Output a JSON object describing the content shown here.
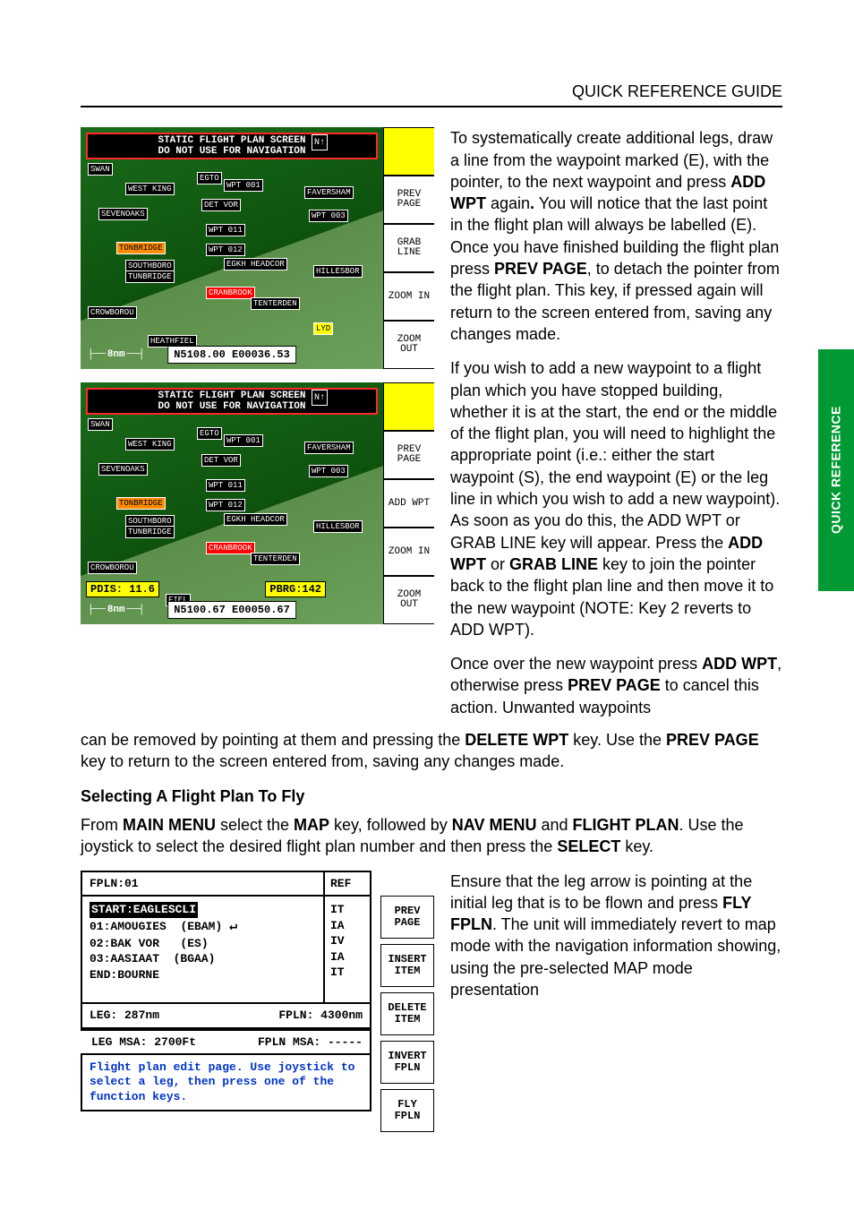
{
  "header": {
    "title": "QUICK REFERENCE GUIDE"
  },
  "side_tab": "QUICK REFERENCE",
  "screens": {
    "banner_line1": "STATIC FLIGHT PLAN SCREEN",
    "banner_line2": "DO NOT USE FOR NAVIGATION",
    "north": "N↑",
    "scale": "8nm",
    "screen1": {
      "coord": "N5108.00 E00036.53",
      "softkeys": [
        "",
        "PREV PAGE",
        "GRAB LINE",
        "ZOOM IN",
        "ZOOM OUT"
      ],
      "labels": {
        "swan": "SWAN",
        "west_king": "WEST KING",
        "det_vor": "DET VOR",
        "sevenoaks": "SEVENOAKS",
        "tonbridge": "TONBRIDGE",
        "southboro": "SOUTHBORO",
        "tunbridge": "TUNBRIDGE",
        "cranbrook": "CRANBROOK",
        "tenterden": "TENTERDEN",
        "crowborou": "CROWBOROU",
        "heathfiel": "HEATHFIEL",
        "faversham": "FAVERSHAM",
        "hillesbor": "HILLESBOR",
        "egto": "EGTO",
        "egkh": "EGKH HEADCOR",
        "wpt001": "WPT 001",
        "wpt003": "WPT 003",
        "wpt011": "WPT 011",
        "wpt012": "WPT 012",
        "lyd": "LYD"
      }
    },
    "screen2": {
      "coord": "N5100.67 E00050.67",
      "pdis": "PDIS: 11.6",
      "pbrg": "PBRG:142",
      "softkeys": [
        "",
        "PREV PAGE",
        "ADD WPT",
        "ZOOM IN",
        "ZOOM OUT"
      ],
      "labels": {
        "fiel": "FIEL"
      }
    }
  },
  "body": {
    "p1_a": "To systematically create additional legs, draw a line from the waypoint marked (E), with the pointer, to the next waypoint and press ",
    "p1_b": "ADD WPT",
    "p1_c": " again",
    "p1_d": ".",
    "p1_e": "  You will notice that the last point in the flight plan will always be labelled (E).  Once you have finished building the flight plan press ",
    "p1_f": "PREV PAGE",
    "p1_g": ", to detach the pointer from the flight plan.  This key, if pressed again will return to the screen entered from, saving any changes made.",
    "p2_a": "If you wish to add a new waypoint to a flight plan which you have stopped building, whether it is at the start, the end or the middle of the flight plan, you will need to highlight the appropriate point (i.e.: either the start waypoint (S), the end waypoint (E) or the leg line in which you wish to add a new waypoint).  As soon as you do this, the ADD WPT or GRAB LINE key will appear.  Press the ",
    "p2_b": "ADD WPT",
    "p2_c": " or ",
    "p2_d": "GRAB LINE",
    "p2_e": " key to join the pointer back to the flight plan line and then move it to the new waypoint (NOTE: Key 2 reverts to ADD WPT).",
    "p3_a": "Once over the new waypoint press ",
    "p3_b": "ADD WPT",
    "p3_c": ", otherwise press ",
    "p3_d": "PREV PAGE",
    "p3_e": " to cancel this action.  Unwanted waypoints ",
    "p3_f": "can be removed by pointing at them and pressing the ",
    "p3_g": "DELETE WPT",
    "p3_h": " key.  Use the ",
    "p3_i": "PREV PAGE",
    "p3_j": " key to return to the screen entered from, saving any changes made.",
    "h_select": "Selecting A Flight Plan To Fly",
    "p4_a": "From ",
    "p4_b": "MAIN MENU",
    "p4_c": " select the ",
    "p4_d": "MAP",
    "p4_e": " key, followed by ",
    "p4_f": "NAV MENU",
    "p4_g": " and ",
    "p4_h": "FLIGHT PLAN",
    "p4_i": ".  Use the joystick to select the desired flight plan number and then press the ",
    "p4_j": "SELECT",
    "p4_k": " key.",
    "p5_a": "Ensure that the leg arrow is pointing at the initial leg that is to be flown and press ",
    "p5_b": "FLY FPLN",
    "p5_c": ".  The unit will immediately revert to map mode with the navigation information showing, using the pre-selected MAP mode presentation"
  },
  "fpln": {
    "title": "FPLN:01",
    "ref_header": "REF",
    "start": "START:EAGLESCLI",
    "rows": [
      {
        "name": "01:AMOUGIES",
        "code": "(EBAM)",
        "ref": "IA"
      },
      {
        "name": "02:BAK VOR",
        "code": "(ES)",
        "ref": "IV"
      },
      {
        "name": "03:AASIAAT",
        "code": "(BGAA)",
        "ref": "IA"
      }
    ],
    "start_ref": "IT",
    "end": "END:BOURNE",
    "end_ref": "IT",
    "leg": "LEG: 287nm",
    "fpln_dist": "FPLN: 4300nm",
    "leg_msa": "LEG MSA: 2700Ft",
    "fpln_msa": "FPLN MSA: -----",
    "hint": "Flight plan edit page. Use joystick to select a leg, then press one of the function keys.",
    "softkeys": [
      "PREV PAGE",
      "INSERT ITEM",
      "DELETE ITEM",
      "INVERT FPLN",
      "FLY FPLN"
    ]
  }
}
